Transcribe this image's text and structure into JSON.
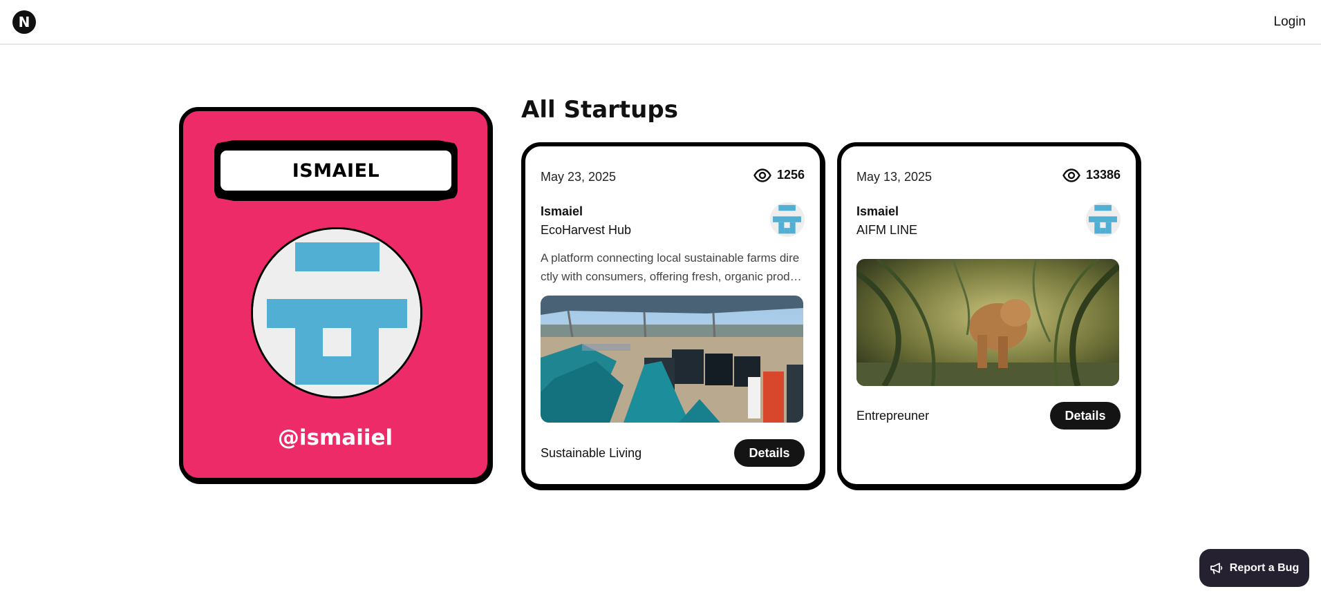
{
  "navbar": {
    "logo_letter": "N",
    "login_label": "Login"
  },
  "profile": {
    "name": "ISMAIEL",
    "handle": "@ismaiiel"
  },
  "section_title": "All Startups",
  "startups": [
    {
      "date": "May 23, 2025",
      "views": "1256",
      "author": "Ismaiel",
      "title": "EcoHarvest Hub",
      "description": "A platform connecting local sustainable farms directly with consumers, offering fresh, organic produce delivered to your door.",
      "category": "Sustainable Living",
      "details_label": "Details",
      "image_subject": "farm greenhouse tanks"
    },
    {
      "date": "May 13, 2025",
      "views": "13386",
      "author": "Ismaiel",
      "title": "AIFM LINE",
      "description": "",
      "category": "Entrepreuner",
      "details_label": "Details",
      "image_subject": "lion cub in grass"
    }
  ],
  "report_bug_label": "Report a Bug",
  "icons": {
    "views": "eye-icon",
    "bug": "megaphone-icon"
  },
  "colors": {
    "profile_card": "#ee2b69",
    "identicon": "#52afd4",
    "button_dark": "#141414"
  }
}
